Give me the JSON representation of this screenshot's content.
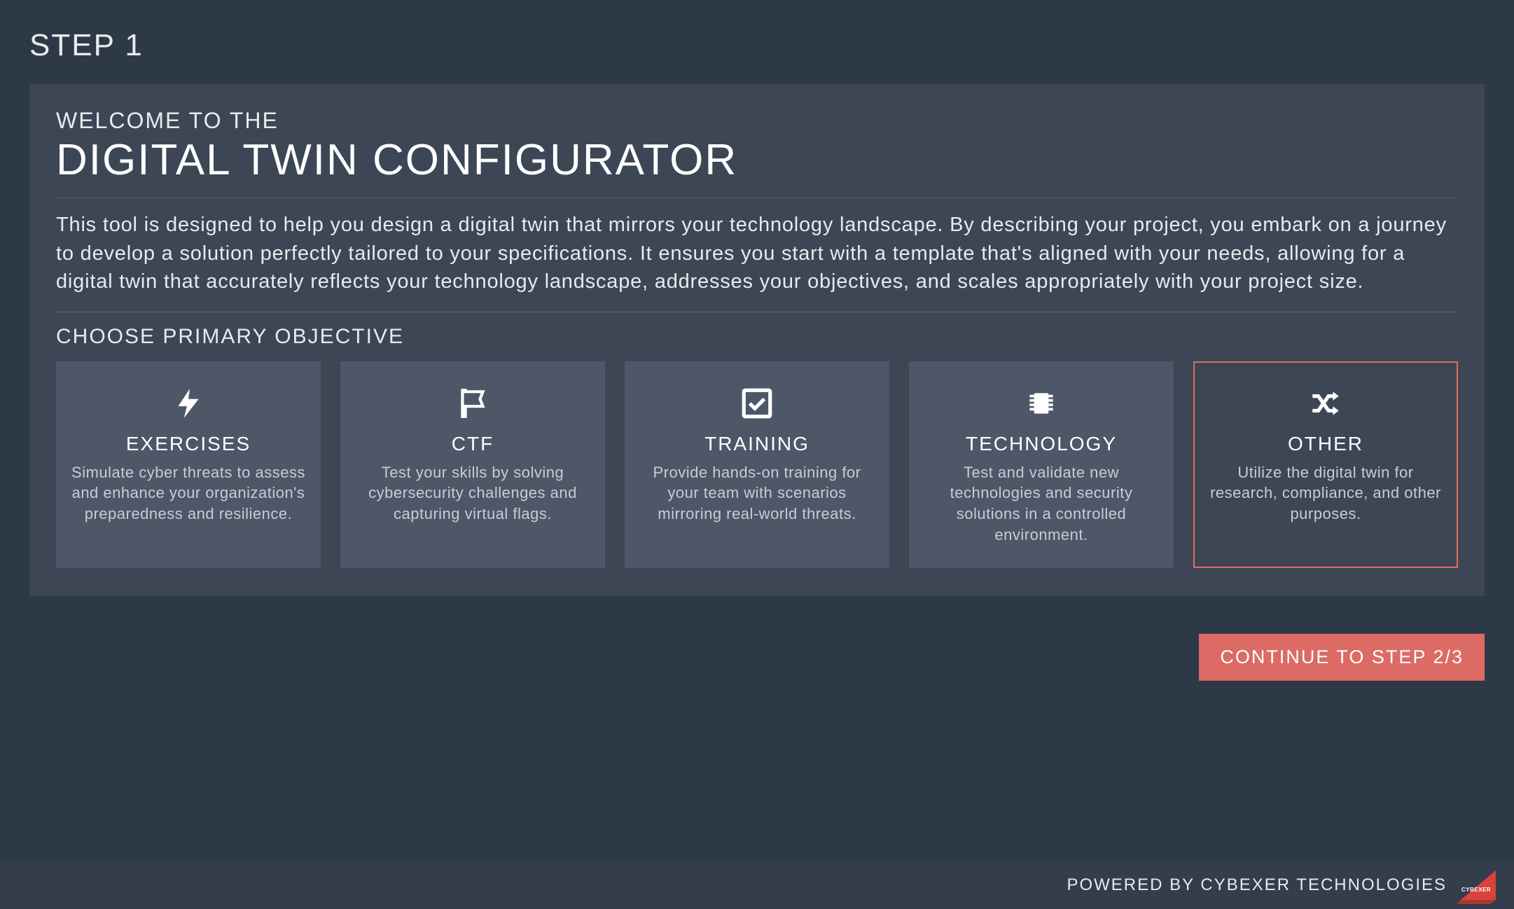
{
  "step_label": "STEP 1",
  "welcome": "WELCOME TO THE",
  "title": "DIGITAL TWIN CONFIGURATOR",
  "description": "This tool is designed to help you design a digital twin that mirrors your technology landscape. By describing your project, you embark on a journey to develop a solution perfectly tailored to your specifications. It ensures you start with a template that's aligned with your needs, allowing for a digital twin that accurately reflects your technology landscape, addresses your objectives, and scales appropriately with your project size.",
  "section_label": "CHOOSE PRIMARY OBJECTIVE",
  "cards": [
    {
      "id": "exercises",
      "icon": "bolt-icon",
      "title": "EXERCISES",
      "desc": "Simulate cyber threats to assess and enhance your organization's preparedness and resilience.",
      "selected": false
    },
    {
      "id": "ctf",
      "icon": "flag-icon",
      "title": "CTF",
      "desc": "Test your skills by solving cybersecurity challenges and capturing virtual flags.",
      "selected": false
    },
    {
      "id": "training",
      "icon": "checkbox-icon",
      "title": "TRAINING",
      "desc": "Provide hands-on training for your team with scenarios mirroring real-world threats.",
      "selected": false
    },
    {
      "id": "technology",
      "icon": "chip-icon",
      "title": "TECHNOLOGY",
      "desc": "Test and validate new technologies and security solutions in a controlled environment.",
      "selected": false
    },
    {
      "id": "other",
      "icon": "shuffle-icon",
      "title": "OTHER",
      "desc": "Utilize the digital twin for research, compliance, and other purposes.",
      "selected": true
    }
  ],
  "continue_label": "CONTINUE TO STEP 2/3",
  "footer_text": "POWERED BY CYBEXER TECHNOLOGIES",
  "footer_brand": "CYBEXER",
  "colors": {
    "accent": "#db6b64",
    "bg": "#2e3947",
    "panel": "#3c4655",
    "card": "#4d5767"
  }
}
